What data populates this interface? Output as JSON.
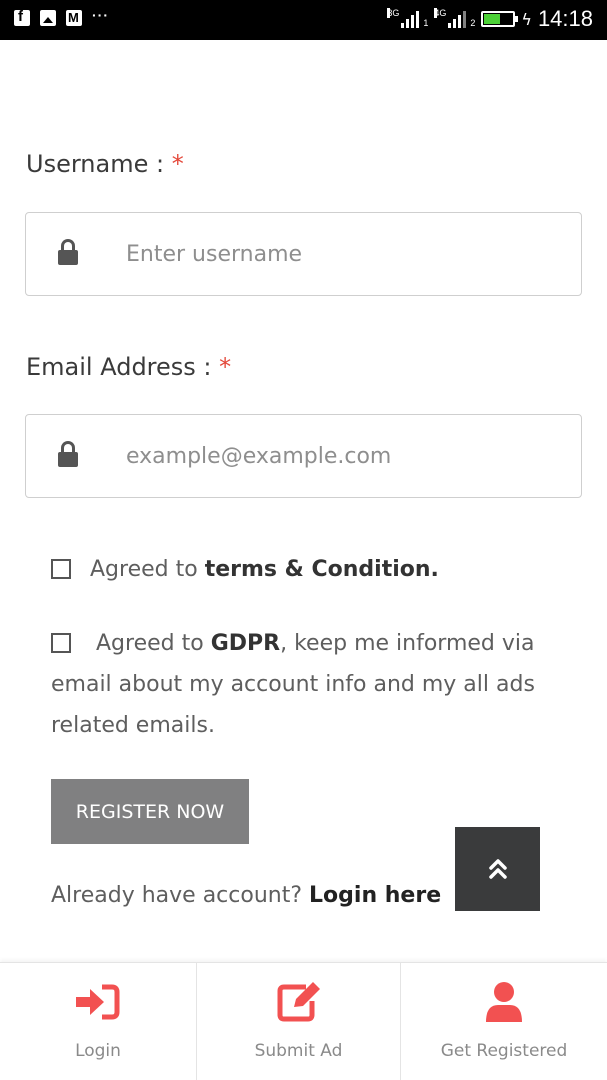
{
  "status_bar": {
    "network_1": "3G",
    "sim_1": "1",
    "network_2": "4G",
    "sim_2": "2",
    "more": "···",
    "time": "14:18",
    "icons": [
      "facebook-icon",
      "gallery-icon",
      "gmail-icon",
      "signal-icon",
      "battery-icon",
      "charging-icon"
    ]
  },
  "form": {
    "username": {
      "label": "Username :",
      "required_mark": "*",
      "placeholder": "Enter username",
      "value": ""
    },
    "email": {
      "label": "Email Address :",
      "required_mark": "*",
      "placeholder": "example@example.com",
      "value": ""
    },
    "terms": {
      "prefix": "Agreed to",
      "link": "terms & Condition.",
      "checked": false
    },
    "gdpr": {
      "prefix": "Agreed to",
      "link": "GDPR",
      "suffix": ", keep me informed via email about my account info and my all ads related emails.",
      "checked": false
    },
    "register_label": "REGISTER NOW",
    "login_prompt": "Already have account?",
    "login_link": "Login here"
  },
  "bottom_nav": {
    "items": [
      {
        "label": "Login",
        "icon": "sign-in-icon"
      },
      {
        "label": "Submit Ad",
        "icon": "edit-icon"
      },
      {
        "label": "Get Registered",
        "icon": "user-icon"
      }
    ]
  },
  "colors": {
    "accent": "#e4483a",
    "button": "#808081",
    "scroll_top": "#3a3b3c",
    "nav_icon": "#f25151"
  }
}
